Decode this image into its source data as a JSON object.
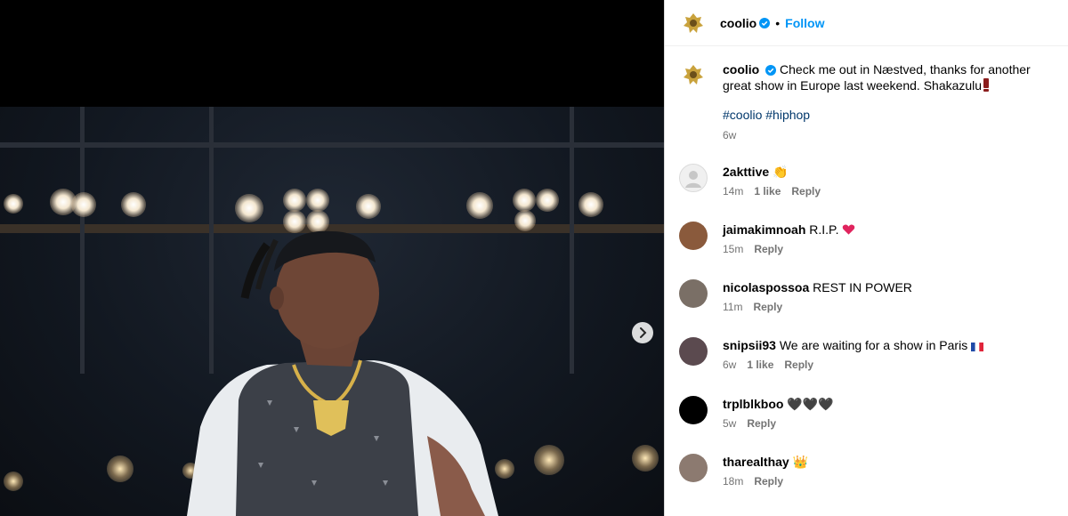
{
  "header": {
    "username": "coolio",
    "separator": "•",
    "follow_label": "Follow"
  },
  "caption": {
    "username": "coolio",
    "text": "Check me out in Næstved, thanks for another great show in Europe last weekend. Shakazulu",
    "hashtags": "#coolio #hiphop",
    "time": "6w"
  },
  "comments": [
    {
      "username": "2akttive",
      "text": "👏",
      "time": "14m",
      "likes": "1 like",
      "reply": "Reply",
      "avatar_color": "#e6e6e6"
    },
    {
      "username": "jaimakimnoah",
      "text": "R.I.P.",
      "time": "15m",
      "reply": "Reply",
      "avatar_color": "#8a5a3c"
    },
    {
      "username": "nicolaspossoa",
      "text": "REST IN POWER",
      "time": "11m",
      "reply": "Reply",
      "avatar_color": "#7a6f66"
    },
    {
      "username": "snipsii93",
      "text": "We are waiting for a show in Paris",
      "time": "6w",
      "likes": "1 like",
      "reply": "Reply",
      "avatar_color": "#5b4a4f"
    },
    {
      "username": "trplblkboo",
      "text": "🖤🖤🖤",
      "time": "5w",
      "reply": "Reply",
      "avatar_color": "#000000"
    },
    {
      "username": "tharealthay",
      "text": "👑",
      "time": "18m",
      "reply": "Reply",
      "avatar_color": "#8c7a70"
    }
  ],
  "colors": {
    "link_blue": "#0095f6",
    "hashtag_blue": "#00376b",
    "heart_red": "#e0245e",
    "verified_blue": "#0095f6"
  }
}
